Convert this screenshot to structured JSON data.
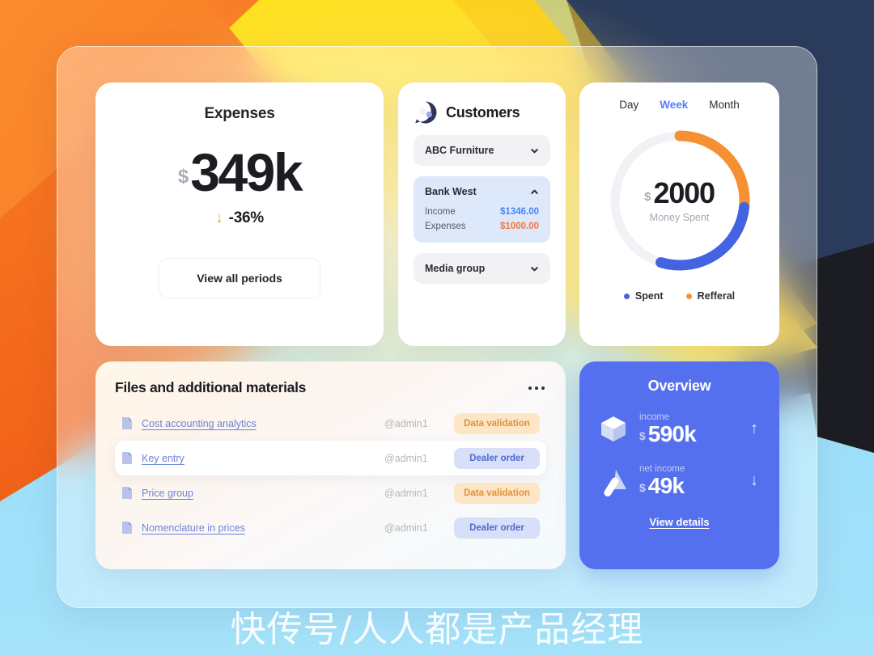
{
  "expenses": {
    "title": "Expenses",
    "currency_symbol": "$",
    "amount": "349k",
    "trend_arrow": "↓",
    "trend_value": "-36%",
    "button_label": "View all periods"
  },
  "customers": {
    "title": "Customers",
    "icon": "customers-bubble-icon",
    "rows": [
      {
        "name": "ABC Furniture",
        "expanded": false
      },
      {
        "name": "Bank West",
        "expanded": true,
        "details": [
          {
            "label": "Income",
            "value": "$1346.00",
            "kind": "income"
          },
          {
            "label": "Expenses",
            "value": "$1000.00",
            "kind": "expense"
          }
        ]
      },
      {
        "name": "Media group",
        "expanded": false
      }
    ]
  },
  "donut": {
    "tabs": [
      {
        "label": "Day",
        "active": false
      },
      {
        "label": "Week",
        "active": true
      },
      {
        "label": "Month",
        "active": false
      }
    ],
    "currency_symbol": "$",
    "center_value": "2000",
    "center_label": "Money Spent",
    "legend": [
      {
        "label": "Spent",
        "color": "#4463e0"
      },
      {
        "label": "Refferal",
        "color": "#f59033"
      }
    ]
  },
  "files": {
    "title": "Files and additional materials",
    "menu_icon": "more-options-icon",
    "rows": [
      {
        "name": "Cost accounting analytics",
        "user": "@admin1",
        "badge": "Data validation",
        "badge_kind": "validation",
        "highlight": false
      },
      {
        "name": "Key entry",
        "user": "@admin1",
        "badge": "Dealer order",
        "badge_kind": "dealer",
        "highlight": true
      },
      {
        "name": "Price group",
        "user": "@admin1",
        "badge": "Data validation",
        "badge_kind": "validation",
        "highlight": false
      },
      {
        "name": "Nomenclature in prices",
        "user": "@admin1",
        "badge": "Dealer order",
        "badge_kind": "dealer",
        "highlight": false
      }
    ]
  },
  "overview": {
    "title": "Overview",
    "items": [
      {
        "label": "income",
        "currency_symbol": "$",
        "amount": "590k",
        "trend": "↑",
        "icon": "cube-icon"
      },
      {
        "label": "net income",
        "currency_symbol": "$",
        "amount": "49k",
        "trend": "↓",
        "icon": "prism-icon"
      }
    ],
    "link_label": "View details"
  },
  "watermark": {
    "text": "快传号/人人都是产品经理"
  },
  "chart_data": {
    "type": "pie",
    "title": "Money Spent",
    "center_value": 2000,
    "unit": "$",
    "legend_position": "bottom",
    "labels": [
      "Refferal",
      "Spent"
    ],
    "values": [
      26,
      29
    ],
    "colors": [
      "#f59033",
      "#4463e0"
    ],
    "track_color": "#f1f2f6",
    "notes": "Donut gauge: orange arc spans ~0°-95° from top, blue arc spans ~95°-196°; remaining ~164° is empty track."
  }
}
